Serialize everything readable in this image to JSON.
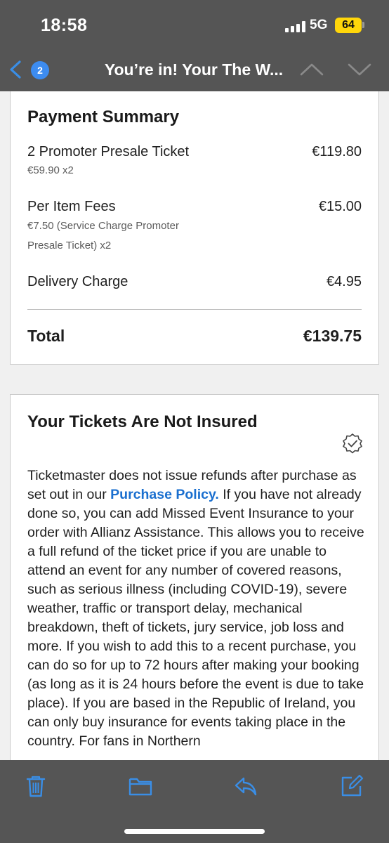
{
  "status": {
    "time": "18:58",
    "network": "5G",
    "battery": "64"
  },
  "nav": {
    "badge_count": "2",
    "title": "You’re in! Your The W..."
  },
  "payment": {
    "heading": "Payment Summary",
    "ticket_label": "2 Promoter Presale Ticket",
    "ticket_amount": "€119.80",
    "ticket_sub": "€59.90 x2",
    "fees_label": "Per Item Fees",
    "fees_amount": "€15.00",
    "fees_sub_1": "€7.50 (Service Charge Promoter",
    "fees_sub_2": "Presale Ticket) x2",
    "delivery_label": "Delivery Charge",
    "delivery_amount": "€4.95",
    "total_label": "Total",
    "total_amount": "€139.75"
  },
  "insurance": {
    "heading": "Your Tickets Are Not Insured",
    "text_before_link": "Ticketmaster does not issue refunds after purchase as set out in our ",
    "link_text": "Purchase Policy.",
    "text_after_link": " If you have not already done so, you can add Missed Event Insurance to your order with Allianz Assistance. This allows you to receive a full refund of the ticket price if you are unable to attend an event for any number of covered reasons, such as serious illness (including COVID-19), severe weather, traffic or transport delay, mechanical breakdown, theft of tickets, jury service, job loss and more. If you wish to add this to a recent purchase, you can do so for up to 72 hours after making your booking (as long as it is 24 hours before the event is due to take place). If you are based in the Republic of Ireland, you can only buy insurance for events taking place in the country. For fans in Northern"
  },
  "toolbar": {
    "icons": [
      "trash-icon",
      "folder-icon",
      "reply-icon",
      "compose-icon"
    ]
  },
  "colors": {
    "bar": "#555555",
    "link": "#1a6fcf",
    "badge": "#3d8cf0",
    "icon_blue": "#3a8ee6",
    "battery": "#ffd60a"
  }
}
